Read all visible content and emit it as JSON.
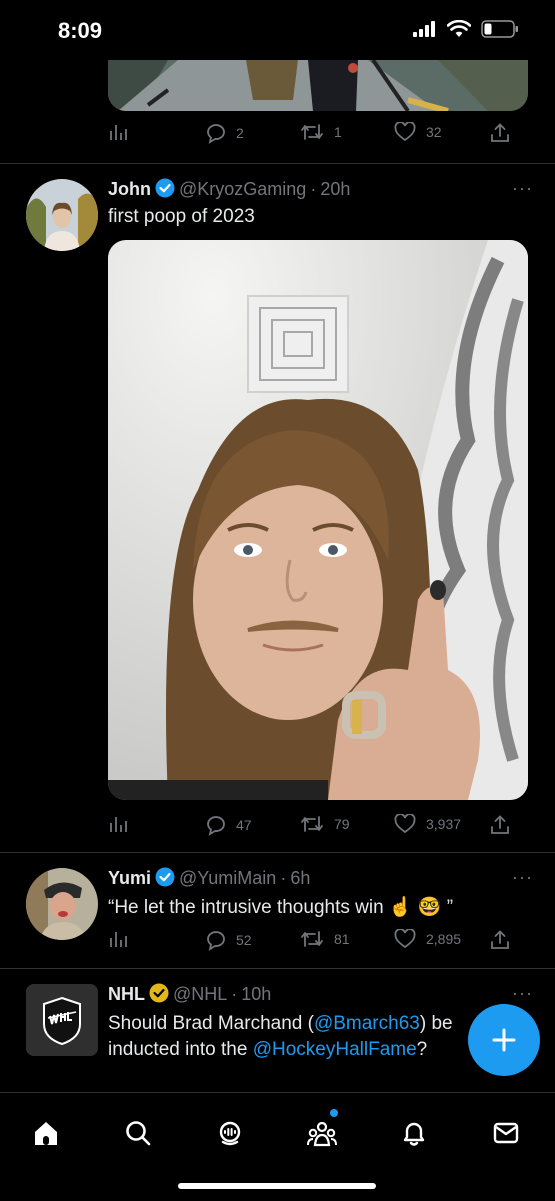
{
  "status_bar": {
    "time": "8:09"
  },
  "tweets": [
    {
      "id": "previous",
      "stats": {
        "replies": "2",
        "retweets": "1",
        "likes": "32"
      }
    },
    {
      "id": "john",
      "name": "John",
      "handle": "@KryozGaming",
      "time": "20h",
      "text": "first poop of 2023",
      "stats": {
        "replies": "47",
        "retweets": "79",
        "likes": "3,937"
      }
    },
    {
      "id": "yumi",
      "name": "Yumi",
      "handle": "@YumiMain",
      "time": "6h",
      "text": "“He let the intrusive thoughts win ☝️ 🤓 ”",
      "stats": {
        "replies": "52",
        "retweets": "81",
        "likes": "2,895"
      }
    },
    {
      "id": "nhl",
      "name": "NHL",
      "handle": "@NHL",
      "time": "10h",
      "text_parts": {
        "p1": "Should Brad Marchand (",
        "m1": "@Bmarch63",
        "p2": ") be",
        "p3": "inducted into the ",
        "m2": "@HockeyHallFame",
        "p4": "?"
      }
    }
  ],
  "separator": "·",
  "more_glyph": "···",
  "icons": {
    "reply": "reply-icon",
    "retweet": "retweet-icon",
    "like": "heart-icon",
    "share": "share-icon",
    "analytics": "analytics-icon",
    "nav": [
      "home-icon",
      "search-icon",
      "spaces-icon",
      "communities-icon",
      "notifications-icon",
      "messages-icon"
    ],
    "fab": "compose-plus-icon"
  },
  "colors": {
    "background": "#000000",
    "accent": "#1d9bf0",
    "muted": "#71767b",
    "text": "#e7e9ea",
    "gold_badge": "#e2b719"
  }
}
